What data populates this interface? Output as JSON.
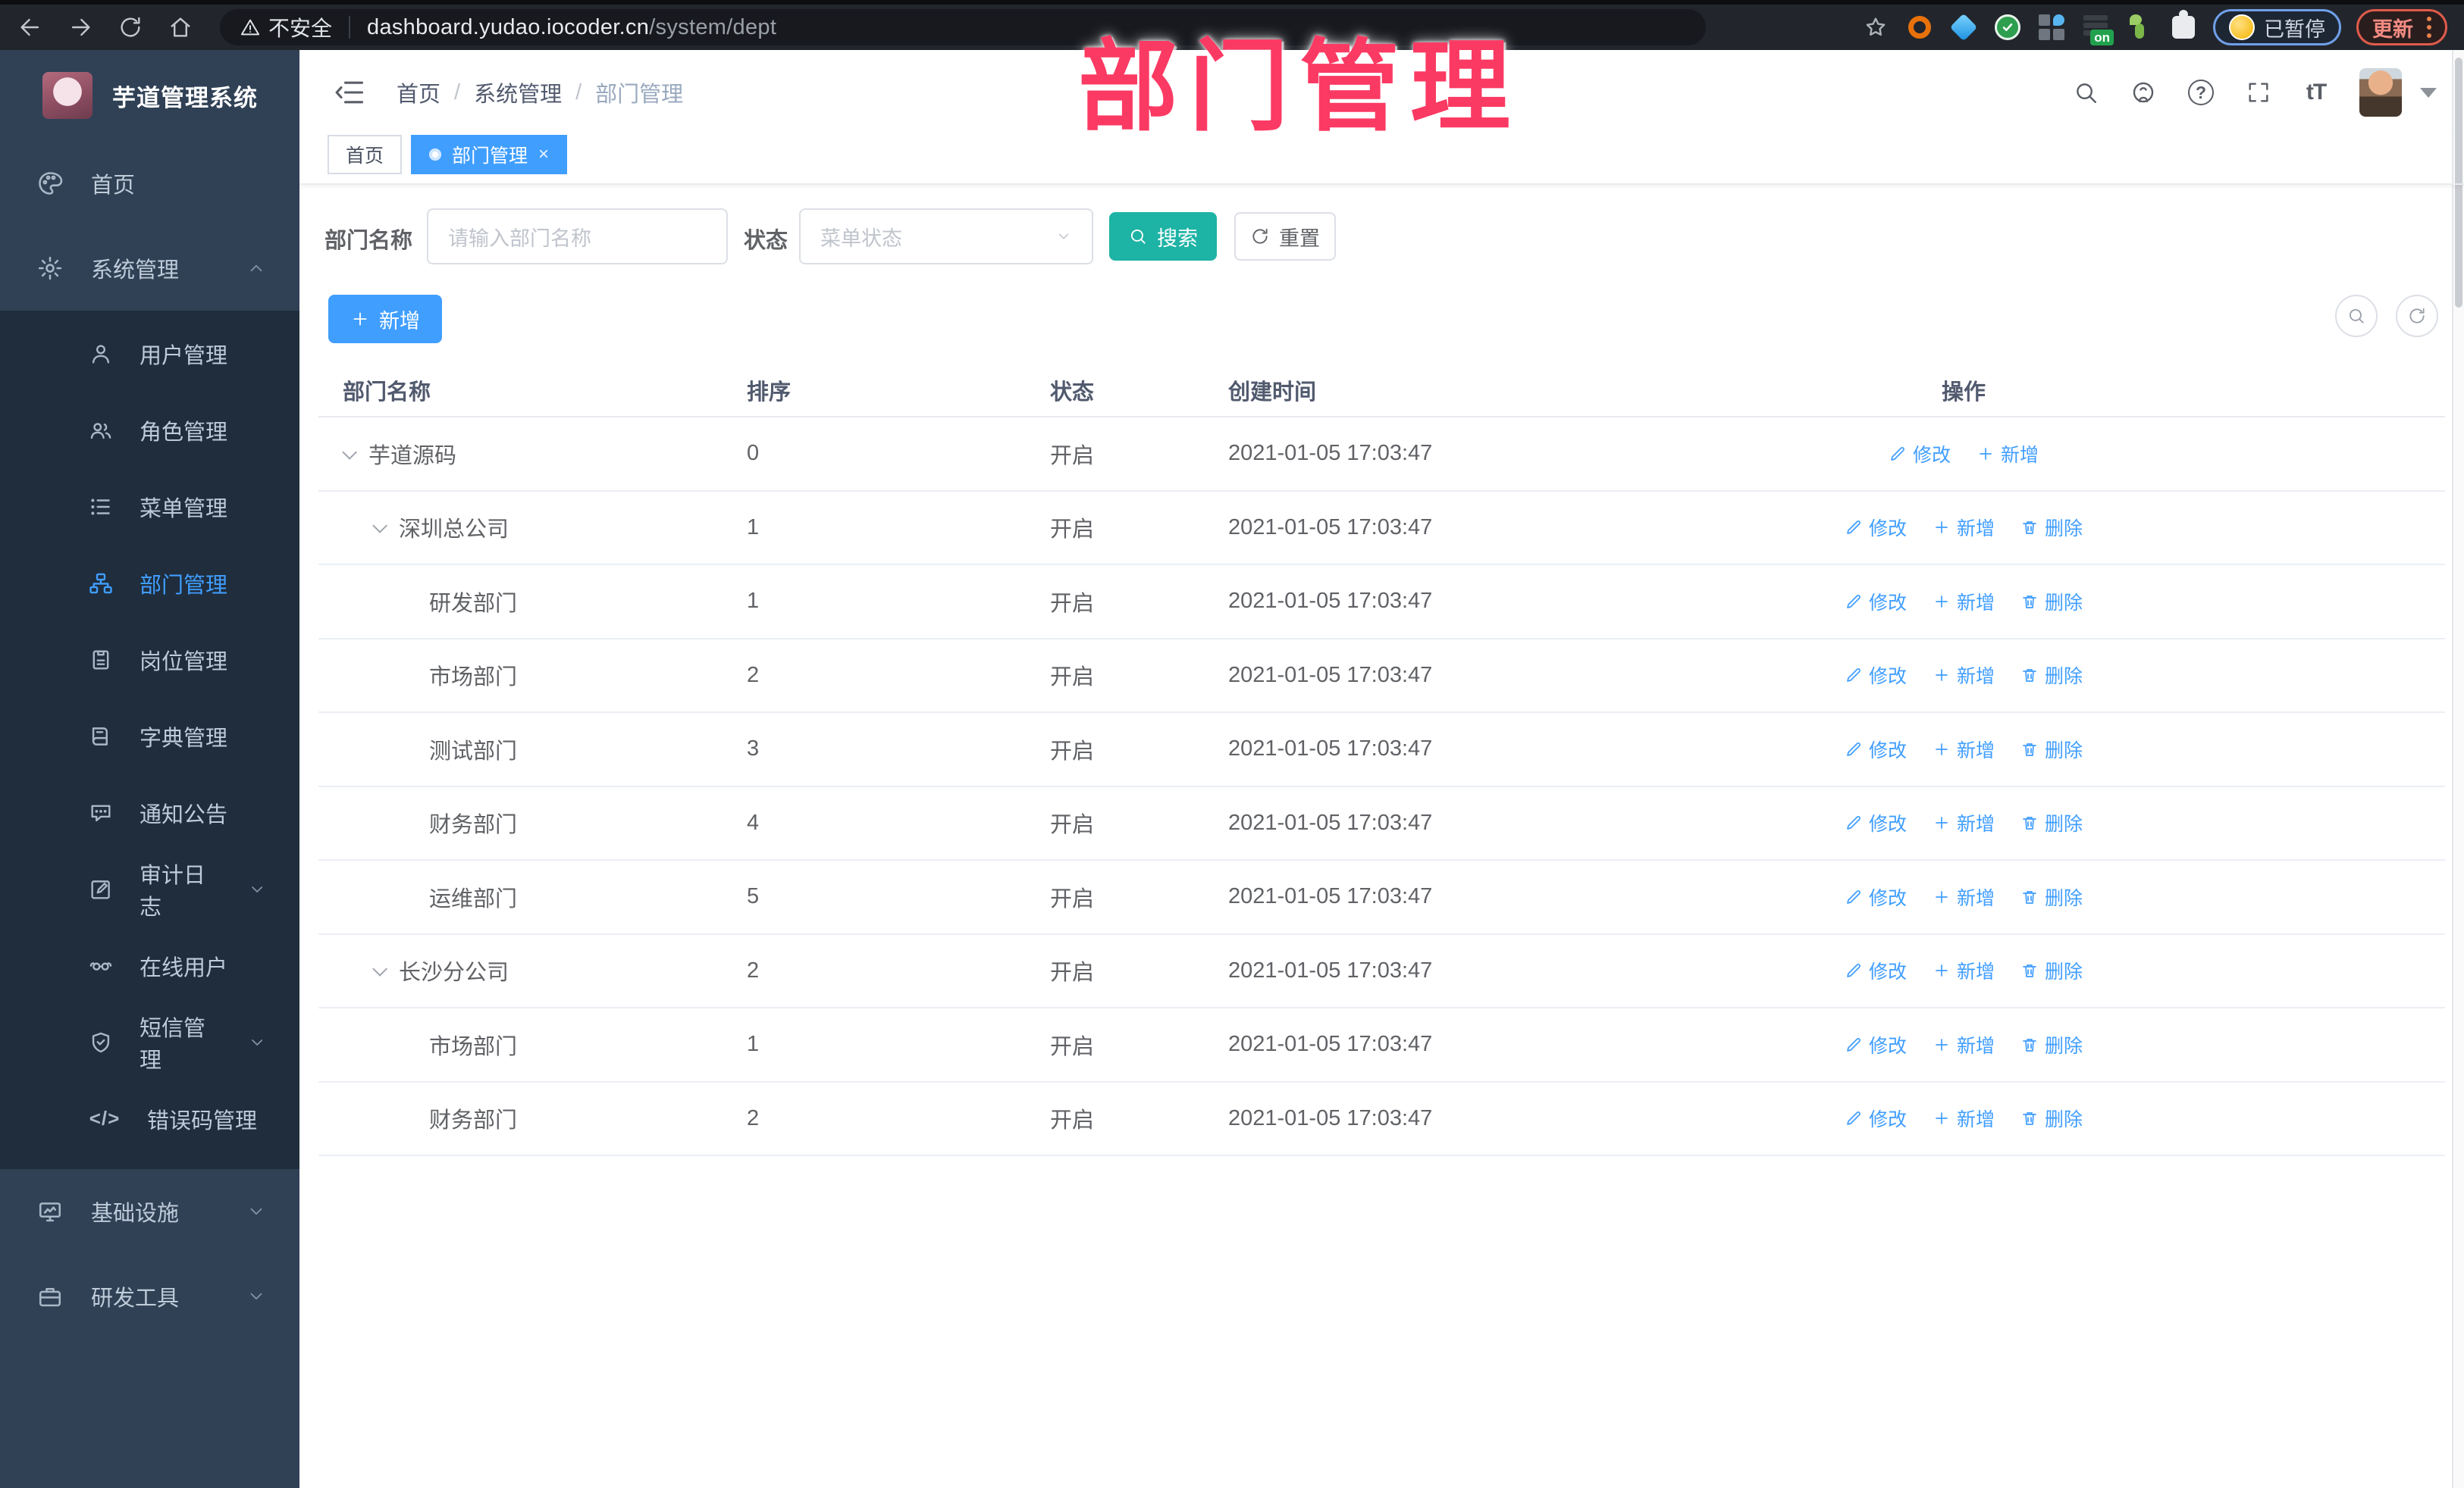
{
  "browser": {
    "security_label": "不安全",
    "url_host": "dashboard.yudao.iocoder.cn",
    "url_path": "/system/dept",
    "paused_badge": "已暂停",
    "update_button": "更新",
    "on_badge": "on"
  },
  "overlay_title": "部门管理",
  "sidebar": {
    "title": "芋道管理系统",
    "items": [
      {
        "label": "首页"
      },
      {
        "label": "系统管理"
      },
      {
        "label": "用户管理"
      },
      {
        "label": "角色管理"
      },
      {
        "label": "菜单管理"
      },
      {
        "label": "部门管理"
      },
      {
        "label": "岗位管理"
      },
      {
        "label": "字典管理"
      },
      {
        "label": "通知公告"
      },
      {
        "label": "审计日志"
      },
      {
        "label": "在线用户"
      },
      {
        "label": "短信管理"
      },
      {
        "label": "错误码管理"
      },
      {
        "label": "基础设施"
      },
      {
        "label": "研发工具"
      }
    ]
  },
  "header": {
    "breadcrumb": [
      "首页",
      "系统管理",
      "部门管理"
    ],
    "help_glyph": "?",
    "font_size_glyph": "tT"
  },
  "tabs": [
    {
      "label": "首页"
    },
    {
      "label": "部门管理"
    }
  ],
  "filters": {
    "name_label": "部门名称",
    "name_placeholder": "请输入部门名称",
    "status_label": "状态",
    "status_placeholder": "菜单状态",
    "search_label": "搜索",
    "reset_label": "重置"
  },
  "toolbar": {
    "add_label": "新增"
  },
  "icons": {
    "errcode_glyph": "</>"
  },
  "table": {
    "columns": [
      "部门名称",
      "排序",
      "状态",
      "创建时间",
      "操作"
    ],
    "action_labels": {
      "edit": "修改",
      "add": "新增",
      "delete": "删除"
    },
    "rows": [
      {
        "name": "芋道源码",
        "sort": "0",
        "status": "开启",
        "created": "2021-01-05 17:03:47",
        "level": 0,
        "expandable": true,
        "actions": [
          "edit",
          "add"
        ]
      },
      {
        "name": "深圳总公司",
        "sort": "1",
        "status": "开启",
        "created": "2021-01-05 17:03:47",
        "level": 1,
        "expandable": true,
        "actions": [
          "edit",
          "add",
          "delete"
        ]
      },
      {
        "name": "研发部门",
        "sort": "1",
        "status": "开启",
        "created": "2021-01-05 17:03:47",
        "level": 2,
        "expandable": false,
        "actions": [
          "edit",
          "add",
          "delete"
        ]
      },
      {
        "name": "市场部门",
        "sort": "2",
        "status": "开启",
        "created": "2021-01-05 17:03:47",
        "level": 2,
        "expandable": false,
        "actions": [
          "edit",
          "add",
          "delete"
        ]
      },
      {
        "name": "测试部门",
        "sort": "3",
        "status": "开启",
        "created": "2021-01-05 17:03:47",
        "level": 2,
        "expandable": false,
        "actions": [
          "edit",
          "add",
          "delete"
        ]
      },
      {
        "name": "财务部门",
        "sort": "4",
        "status": "开启",
        "created": "2021-01-05 17:03:47",
        "level": 2,
        "expandable": false,
        "actions": [
          "edit",
          "add",
          "delete"
        ]
      },
      {
        "name": "运维部门",
        "sort": "5",
        "status": "开启",
        "created": "2021-01-05 17:03:47",
        "level": 2,
        "expandable": false,
        "actions": [
          "edit",
          "add",
          "delete"
        ]
      },
      {
        "name": "长沙分公司",
        "sort": "2",
        "status": "开启",
        "created": "2021-01-05 17:03:47",
        "level": 1,
        "expandable": true,
        "actions": [
          "edit",
          "add",
          "delete"
        ]
      },
      {
        "name": "市场部门",
        "sort": "1",
        "status": "开启",
        "created": "2021-01-05 17:03:47",
        "level": 2,
        "expandable": false,
        "actions": [
          "edit",
          "add",
          "delete"
        ]
      },
      {
        "name": "财务部门",
        "sort": "2",
        "status": "开启",
        "created": "2021-01-05 17:03:47",
        "level": 2,
        "expandable": false,
        "actions": [
          "edit",
          "add",
          "delete"
        ]
      }
    ]
  }
}
